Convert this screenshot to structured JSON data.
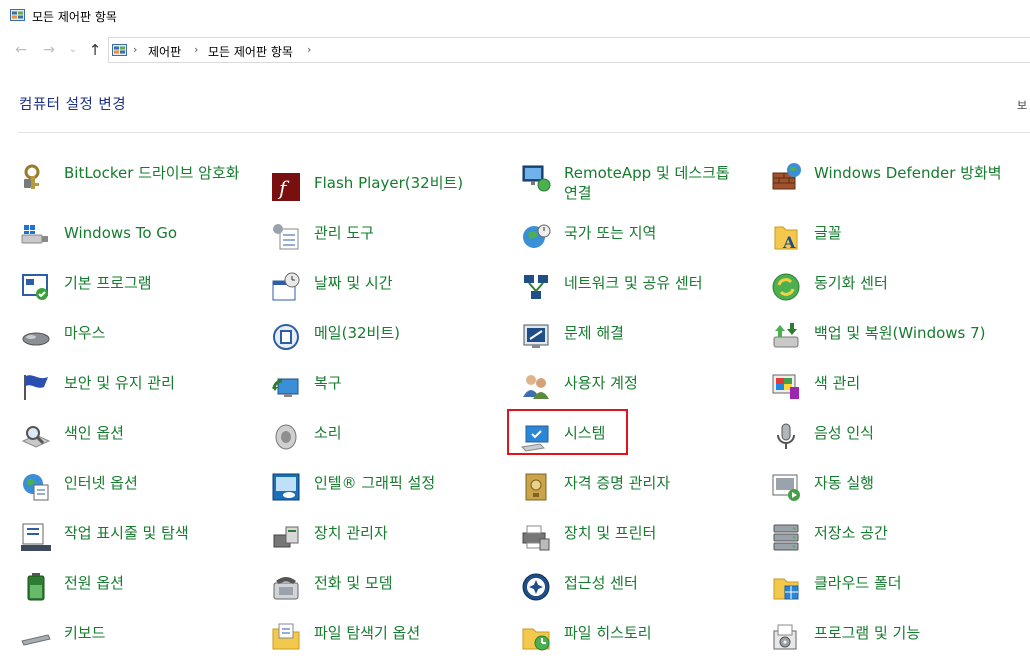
{
  "window": {
    "title": "모든 제어판 항목"
  },
  "nav": {
    "back_glyph": "←",
    "forward_glyph": "→",
    "dropdown_glyph": "⌄",
    "up_glyph": "↑"
  },
  "breadcrumb": {
    "items": [
      "제어판",
      "모든 제어판 항목"
    ],
    "separator": "›"
  },
  "heading": "컴퓨터 설정 변경",
  "viewby_partial": "보",
  "colors": {
    "link_green": "#167c2e",
    "heading_blue": "#1e3287",
    "highlight_red": "#e0141a"
  },
  "items": [
    {
      "label": "BitLocker 드라이브 암호화",
      "icon": "key-lock-icon"
    },
    {
      "label": "Flash Player(32비트)",
      "icon": "flash-icon"
    },
    {
      "label": "RemoteApp 및 데스크톱 연결",
      "icon": "remote-desktop-icon"
    },
    {
      "label": "Windows Defender 방화벽",
      "icon": "firewall-icon"
    },
    {
      "label": "Windows To Go",
      "icon": "usb-drive-icon"
    },
    {
      "label": "관리 도구",
      "icon": "admin-tools-icon"
    },
    {
      "label": "국가 또는 지역",
      "icon": "globe-clock-icon"
    },
    {
      "label": "글꼴",
      "icon": "font-folder-icon"
    },
    {
      "label": "기본 프로그램",
      "icon": "default-programs-icon"
    },
    {
      "label": "날짜 및 시간",
      "icon": "calendar-clock-icon"
    },
    {
      "label": "네트워크 및 공유 센터",
      "icon": "network-icon"
    },
    {
      "label": "동기화 센터",
      "icon": "sync-icon"
    },
    {
      "label": "마우스",
      "icon": "mouse-icon"
    },
    {
      "label": "메일(32비트)",
      "icon": "mail-icon"
    },
    {
      "label": "문제 해결",
      "icon": "troubleshoot-icon"
    },
    {
      "label": "백업 및 복원(Windows 7)",
      "icon": "backup-icon"
    },
    {
      "label": "보안 및 유지 관리",
      "icon": "flag-icon"
    },
    {
      "label": "복구",
      "icon": "recovery-icon"
    },
    {
      "label": "사용자 계정",
      "icon": "users-icon"
    },
    {
      "label": "색 관리",
      "icon": "color-management-icon"
    },
    {
      "label": "색인 옵션",
      "icon": "indexing-icon"
    },
    {
      "label": "소리",
      "icon": "speaker-icon"
    },
    {
      "label": "시스템",
      "icon": "system-icon"
    },
    {
      "label": "음성 인식",
      "icon": "microphone-icon"
    },
    {
      "label": "인터넷 옵션",
      "icon": "internet-options-icon"
    },
    {
      "label": "인텔® 그래픽 설정",
      "icon": "intel-graphics-icon"
    },
    {
      "label": "자격 증명 관리자",
      "icon": "credential-vault-icon"
    },
    {
      "label": "자동 실행",
      "icon": "autoplay-icon"
    },
    {
      "label": "작업 표시줄 및 탐색",
      "icon": "taskbar-icon"
    },
    {
      "label": "장치 관리자",
      "icon": "device-manager-icon"
    },
    {
      "label": "장치 및 프린터",
      "icon": "printer-icon"
    },
    {
      "label": "저장소 공간",
      "icon": "storage-spaces-icon"
    },
    {
      "label": "전원 옵션",
      "icon": "battery-icon"
    },
    {
      "label": "전화 및 모뎀",
      "icon": "phone-modem-icon"
    },
    {
      "label": "접근성 센터",
      "icon": "ease-of-access-icon"
    },
    {
      "label": "클라우드 폴더",
      "icon": "cloud-folder-icon"
    },
    {
      "label": "키보드",
      "icon": "keyboard-icon"
    },
    {
      "label": "파일 탐색기 옵션",
      "icon": "folder-options-icon"
    },
    {
      "label": "파일 히스토리",
      "icon": "file-history-icon"
    },
    {
      "label": "프로그램 및 기능",
      "icon": "programs-features-icon"
    }
  ]
}
